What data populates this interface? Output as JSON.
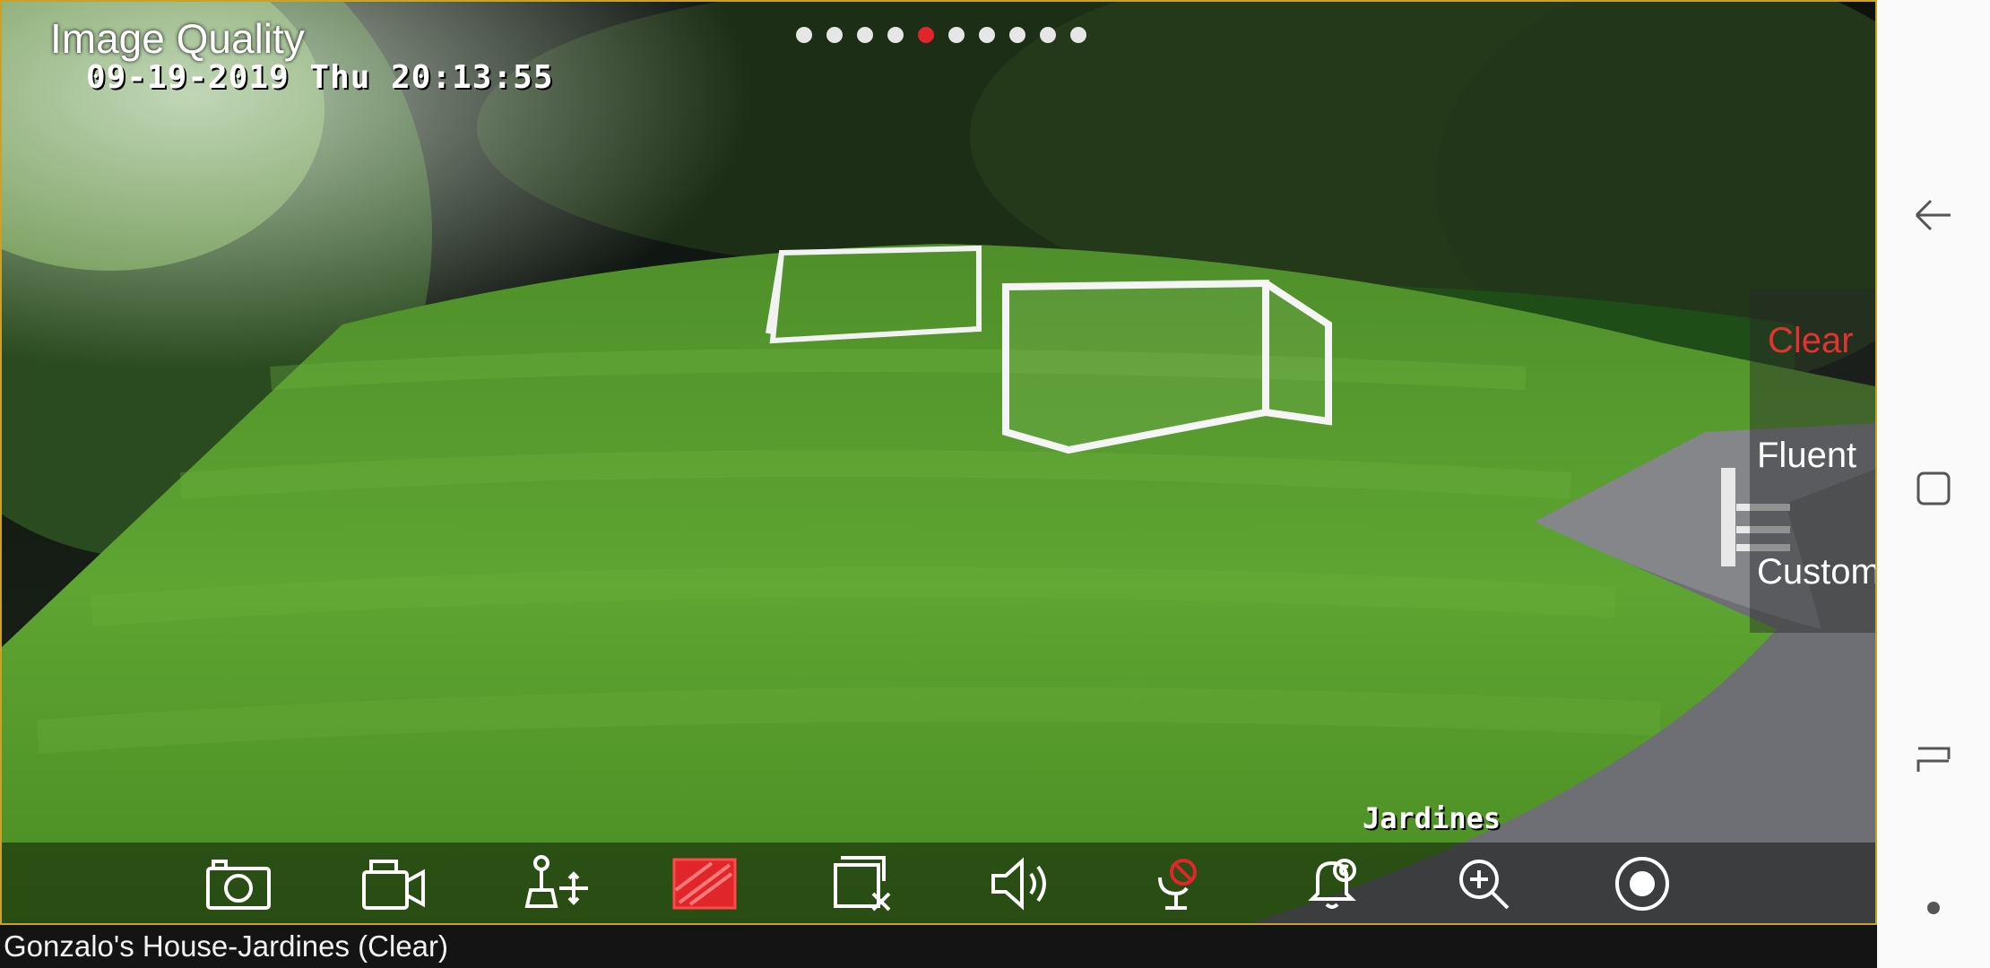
{
  "app": {
    "title": "Image Quality",
    "pager": {
      "count": 10,
      "active_index": 4
    }
  },
  "camera": {
    "osd_timestamp": "09-19-2019 Thu 20:13:55",
    "osd_channel_name": "Jardines"
  },
  "quality_menu": {
    "options": [
      "Clear",
      "Fluent",
      "Custom"
    ],
    "selected": "Clear"
  },
  "toolbar": {
    "items": [
      {
        "name": "snapshot-icon"
      },
      {
        "name": "record-icon"
      },
      {
        "name": "ptz-icon"
      },
      {
        "name": "quality-icon",
        "active_color": "#e0262b"
      },
      {
        "name": "close-window-icon"
      },
      {
        "name": "audio-icon"
      },
      {
        "name": "talk-disabled-icon"
      },
      {
        "name": "alarm-icon"
      },
      {
        "name": "zoom-icon"
      },
      {
        "name": "fisheye-icon"
      }
    ]
  },
  "caption": "Gonzalo's House-Jardines (Clear)",
  "navbar": {
    "back": "back-icon",
    "home": "home-icon",
    "recents": "recents-icon",
    "assist": "dot-icon"
  },
  "colors": {
    "accent_red": "#e0262b",
    "frame_border": "#c9a227"
  }
}
